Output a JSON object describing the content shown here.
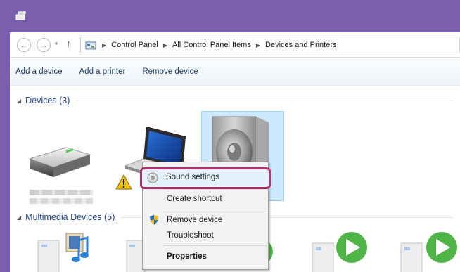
{
  "window": {
    "frame_color": "#7a5fae",
    "title_icon": "devices-printers-icon"
  },
  "addressbar": {
    "back_icon": "back-arrow-icon",
    "forward_icon": "forward-arrow-icon",
    "up_icon": "up-arrow-icon",
    "location_icon": "control-panel-icon",
    "breadcrumbs": [
      "Control Panel",
      "All Control Panel Items",
      "Devices and Printers"
    ]
  },
  "toolbar": {
    "items": [
      "Add a device",
      "Add a printer",
      "Remove device"
    ]
  },
  "groups": {
    "devices": {
      "label": "Devices (3)"
    },
    "multimedia": {
      "label": "Multimedia Devices (5)"
    }
  },
  "devices": [
    {
      "icon": "hard-drive-icon"
    },
    {
      "icon": "laptop-icon",
      "badge": "warning-icon"
    },
    {
      "icon": "speaker-icon",
      "selected": true
    }
  ],
  "multimedia_devices": [
    {
      "icon": "media-device-music-icon"
    },
    {
      "icon": "media-server-icon"
    },
    {
      "icon": "media-player-icon"
    },
    {
      "icon": "media-player-icon"
    },
    {
      "icon": "media-player-icon"
    }
  ],
  "context_menu": {
    "items": [
      {
        "label": "Sound settings",
        "icon": "sound-settings-icon",
        "highlighted": true
      },
      {
        "label": "Create shortcut"
      },
      {
        "label": "Remove device",
        "icon": "shield-icon"
      },
      {
        "label": "Troubleshoot"
      },
      {
        "label": "Properties",
        "bold": true
      }
    ],
    "highlight_color": "#b0336a"
  }
}
